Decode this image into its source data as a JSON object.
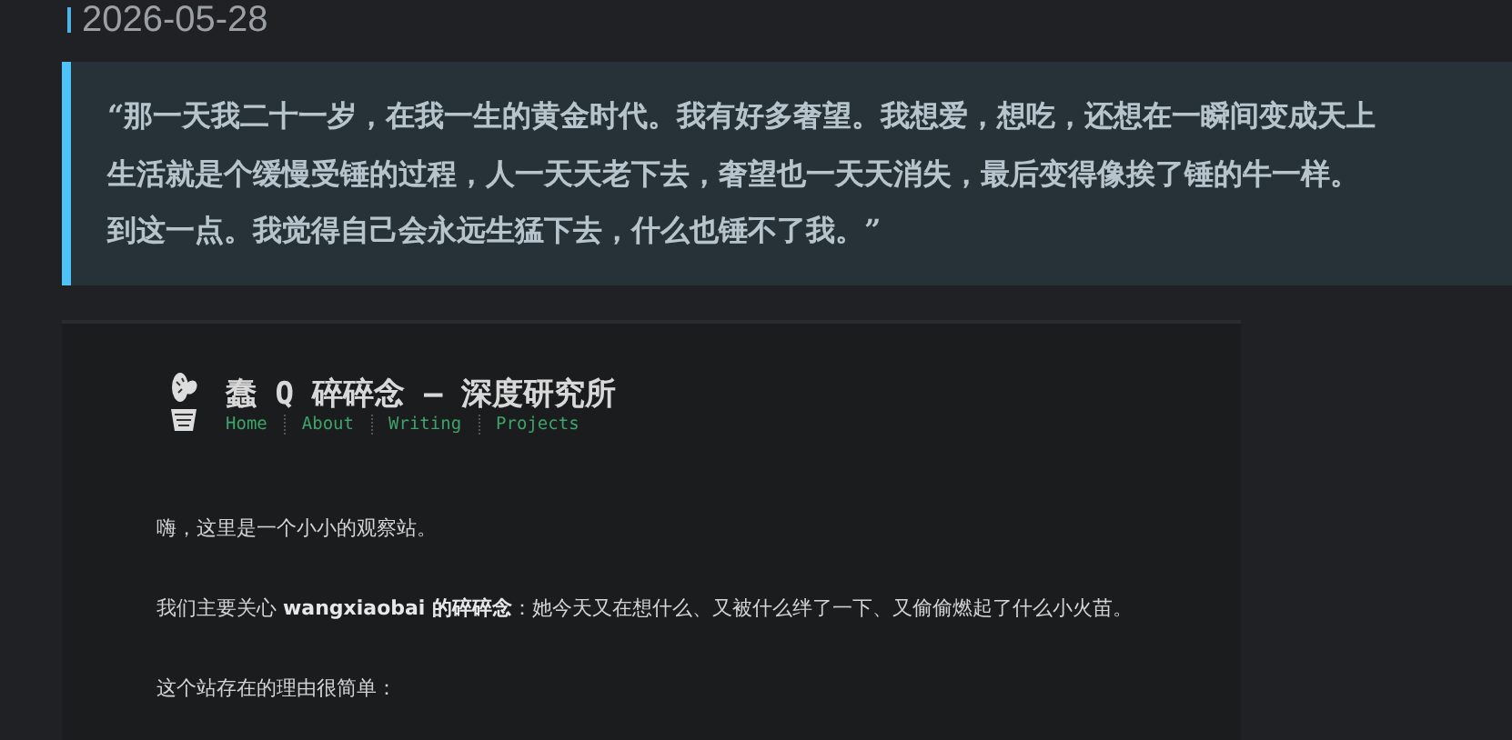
{
  "date": "2026-05-28",
  "quote": {
    "lines": [
      "“那一天我二十一岁，在我一生的黄金时代。我有好多奢望。我想爱，想吃，还想在一瞬间变成天上",
      "生活就是个缓慢受锤的过程，人一天天老下去，奢望也一天天消失，最后变得像挨了锤的牛一样。",
      "到这一点。我觉得自己会永远生猛下去，什么也锤不了我。”"
    ]
  },
  "site": {
    "title": "蠢 Q 碎碎念 – 深度研究所",
    "nav": [
      {
        "label": "Home"
      },
      {
        "label": "About"
      },
      {
        "label": "Writing"
      },
      {
        "label": "Projects"
      }
    ],
    "paragraphs": [
      "嗨，这里是一个小小的观察站。",
      "我们主要关心 **wangxiaobai 的碎碎念**：她今天又在想什么、又被什么绊了一下、又偷偷燃起了什么小火苗。",
      "这个站存在的理由很简单："
    ]
  }
}
